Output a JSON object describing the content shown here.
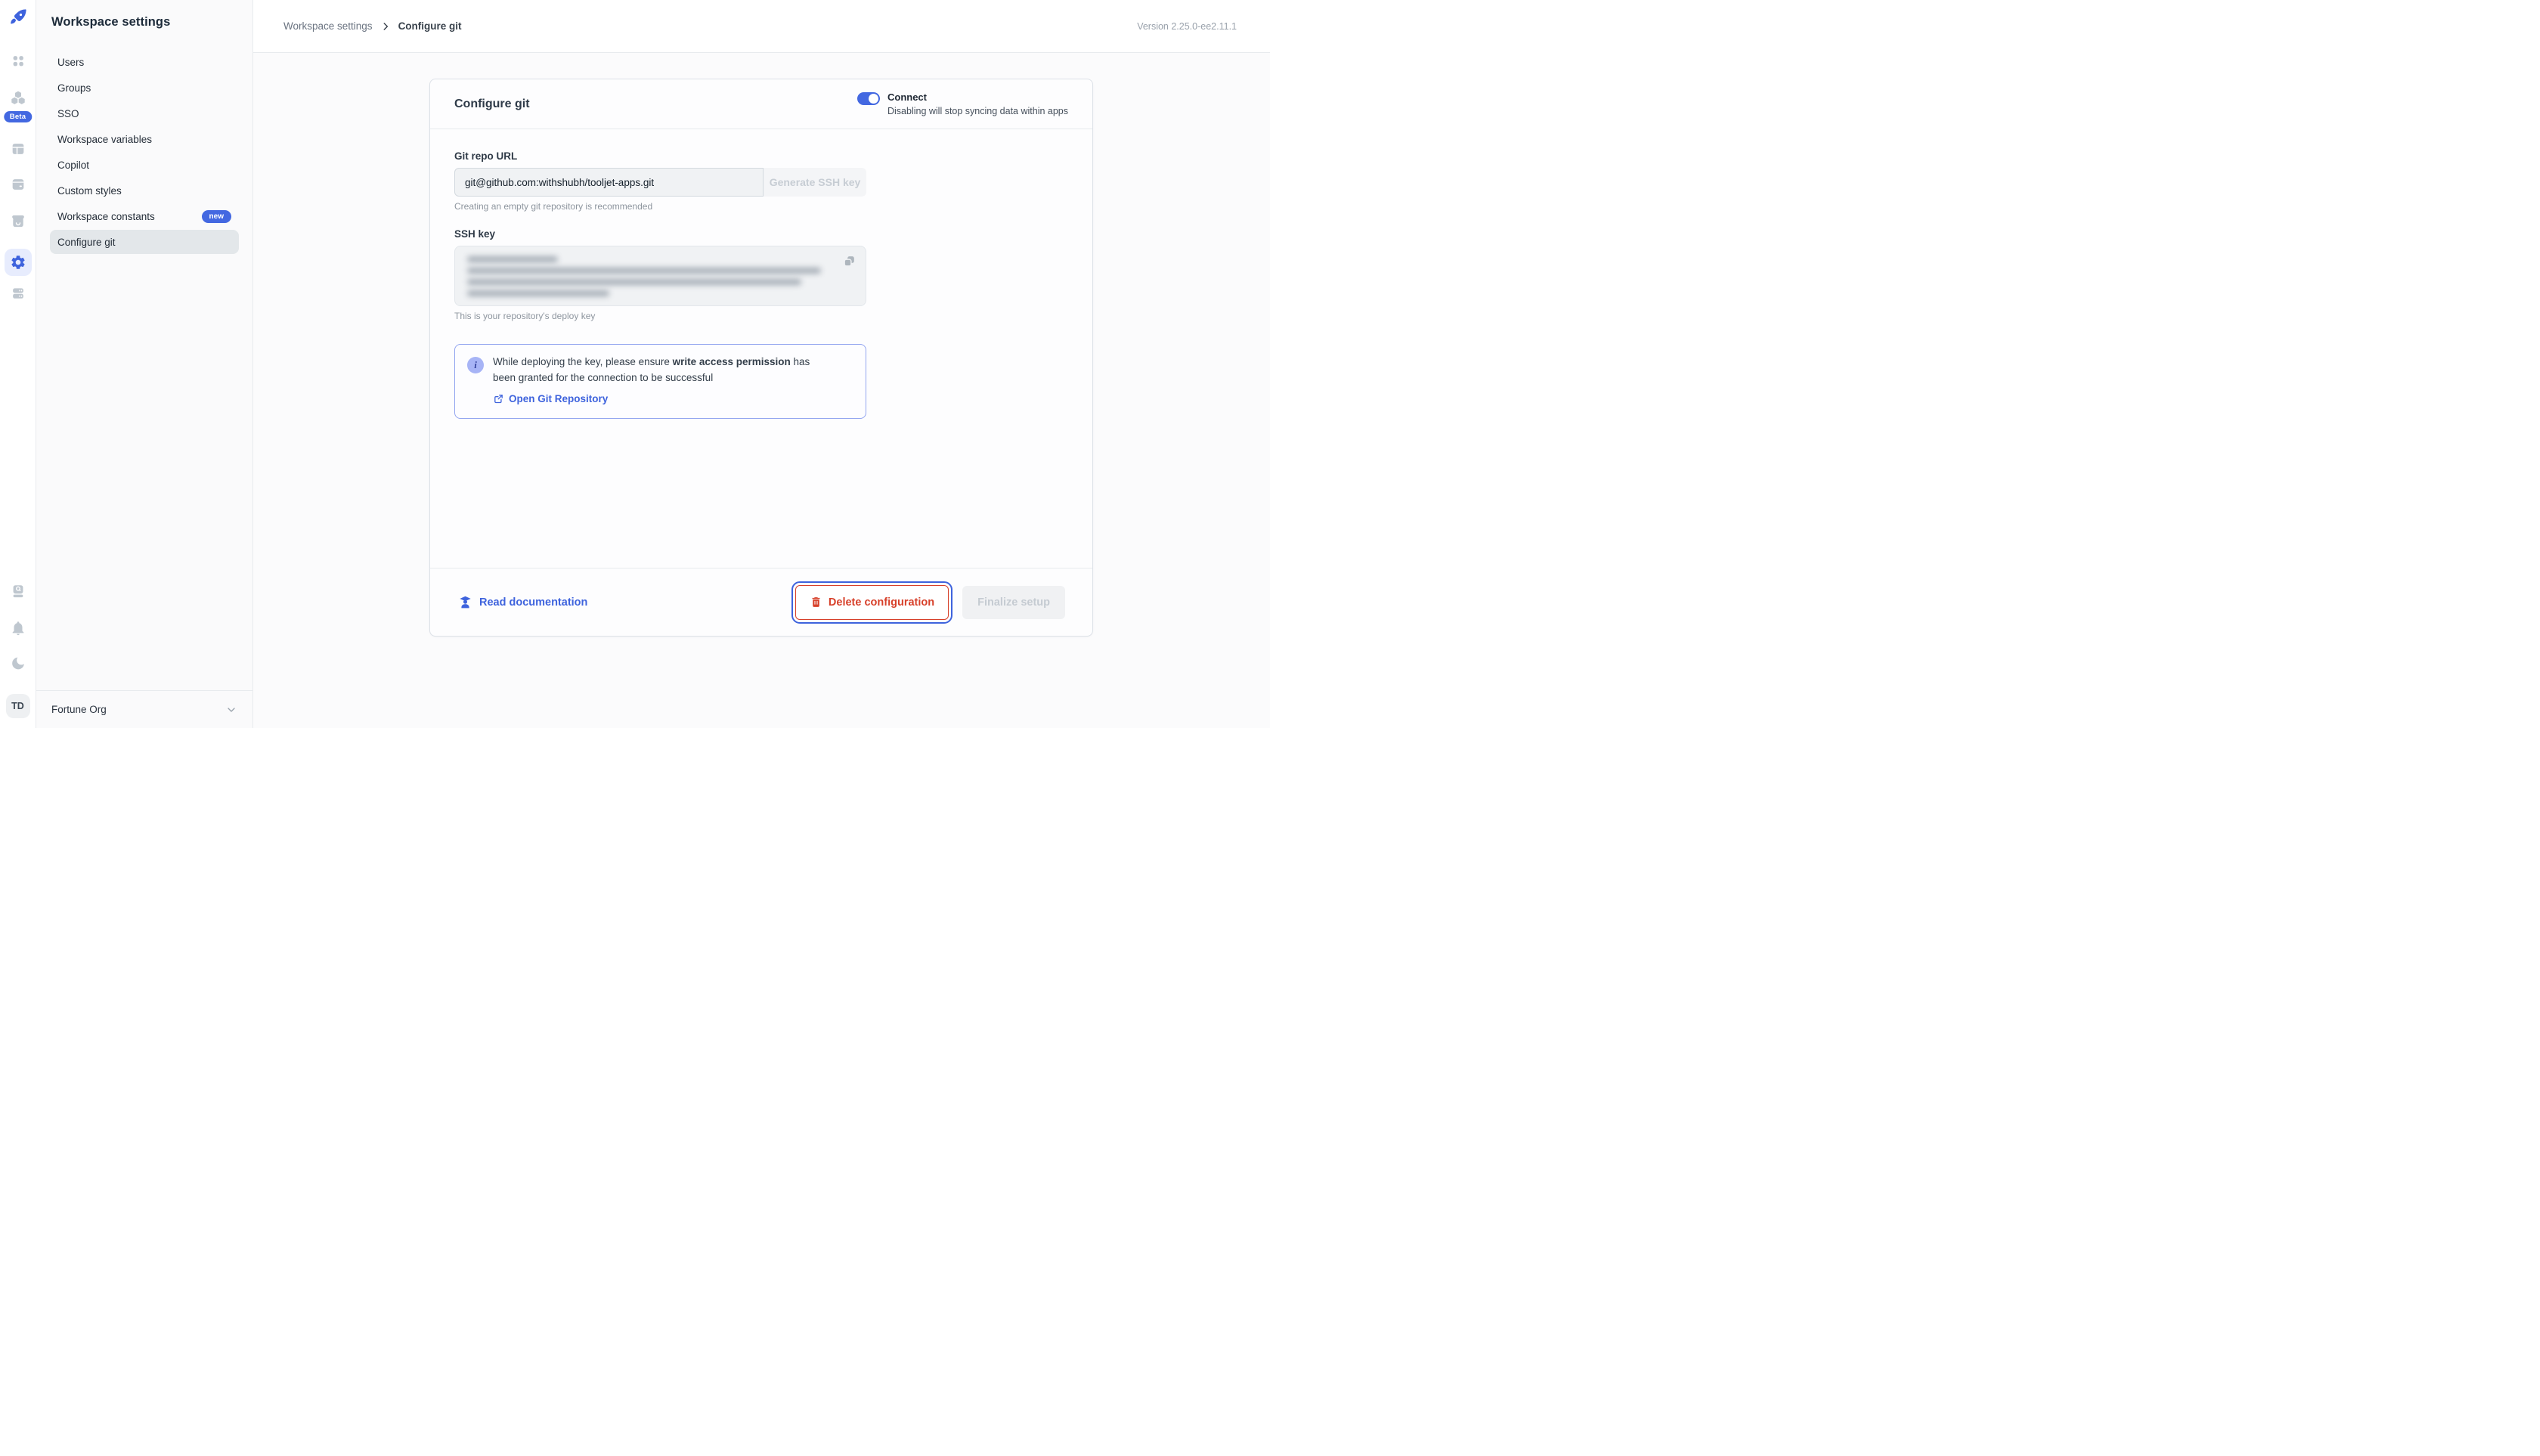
{
  "version_label": "Version 2.25.0-ee2.11.1",
  "rail": {
    "beta_badge": "Beta",
    "avatar_initials": "TD"
  },
  "sidebar": {
    "title": "Workspace settings",
    "items": [
      {
        "label": "Users"
      },
      {
        "label": "Groups"
      },
      {
        "label": "SSO"
      },
      {
        "label": "Workspace variables"
      },
      {
        "label": "Copilot"
      },
      {
        "label": "Custom styles"
      },
      {
        "label": "Workspace constants",
        "badge": "new"
      },
      {
        "label": "Configure git"
      }
    ],
    "org_name": "Fortune Org"
  },
  "breadcrumb": {
    "parent": "Workspace settings",
    "current": "Configure git"
  },
  "card": {
    "title": "Configure git",
    "toggle_label": "Connect",
    "toggle_description": "Disabling will stop syncing data within apps",
    "git_repo": {
      "label": "Git repo URL",
      "value": "git@github.com:withshubh/tooljet-apps.git",
      "button": "Generate SSH key",
      "helper": "Creating an empty git repository is recommended"
    },
    "ssh_key": {
      "label": "SSH key",
      "helper": "This is your repository's deploy key"
    },
    "info": {
      "icon_glyph": "i",
      "text_prefix": "While deploying the key, please ensure ",
      "text_bold": "write access permission",
      "text_suffix": " has been granted for the connection to be successful",
      "link": "Open Git Repository"
    },
    "footer": {
      "docs_link": "Read documentation",
      "delete_button": "Delete configuration",
      "finalize_button": "Finalize setup"
    }
  },
  "colors": {
    "accent": "#4368e1",
    "danger": "#d7402a"
  }
}
